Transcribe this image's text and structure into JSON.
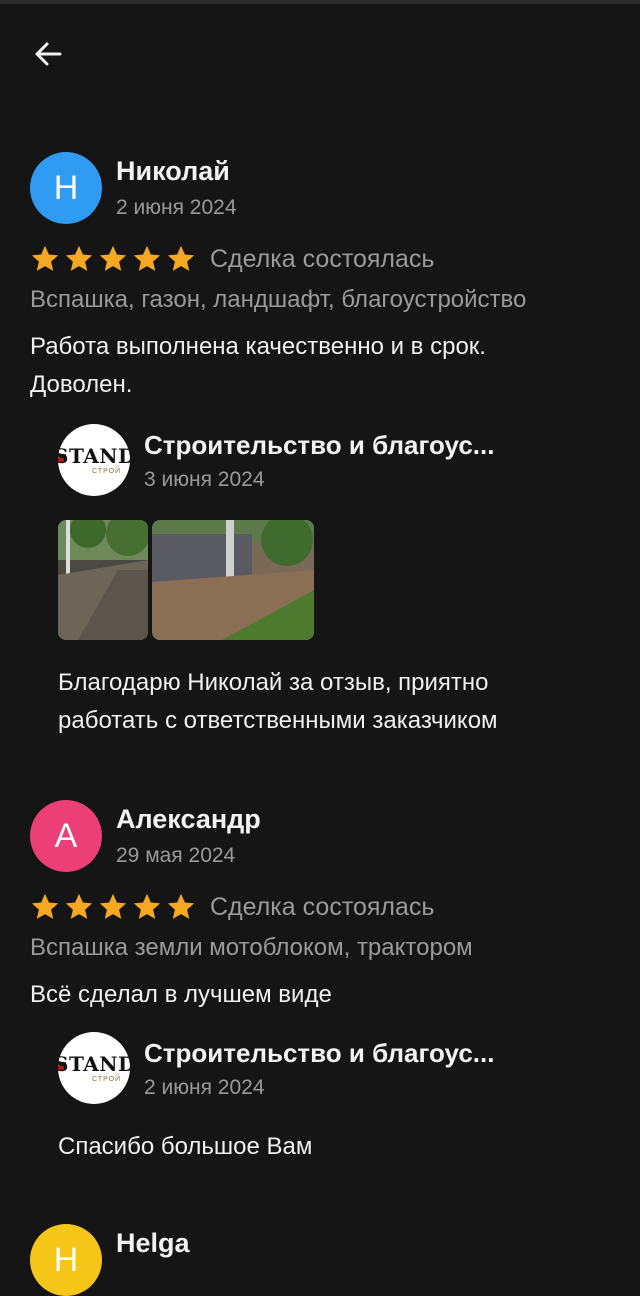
{
  "header": {
    "back_icon": "arrow-left-icon"
  },
  "reviews": [
    {
      "initial": "Н",
      "avatar_color": "#2f9bf2",
      "name": "Николай",
      "date": "2 июня 2024",
      "rating": 5,
      "deal_status": "Сделка состоялась",
      "tags": "Вспашка, газон, ландшафт, благоустройство",
      "text_lines": [
        "Работа выполнена качественно и в срок.",
        "Доволен."
      ],
      "reply": {
        "company": "Строительство и благоус...",
        "logo_text": "STANDAI",
        "logo_sub": "СТРОЙ",
        "date": "3 июня 2024",
        "text_lines": [
          "Благодарю Николай за отзыв, приятно",
          "работать с ответственными заказчиком"
        ]
      }
    },
    {
      "initial": "А",
      "avatar_color": "#ec3f78",
      "name": "Александр",
      "date": "29 мая 2024",
      "rating": 5,
      "deal_status": "Сделка состоялась",
      "tags": "Вспашка земли мотоблоком, трактором",
      "text_lines": [
        "Всё сделал в лучшем виде"
      ],
      "reply": {
        "company": "Строительство и благоус...",
        "logo_text": "STANDAI",
        "logo_sub": "СТРОЙ",
        "date": "2 июня 2024",
        "text_lines": [
          "Спасибо большое Вам"
        ]
      }
    },
    {
      "initial": "Н",
      "avatar_color": "#f5c518",
      "name": "Helga"
    }
  ],
  "colors": {
    "star": "#f7a823",
    "background": "#151515",
    "muted": "#9a9a9a"
  }
}
